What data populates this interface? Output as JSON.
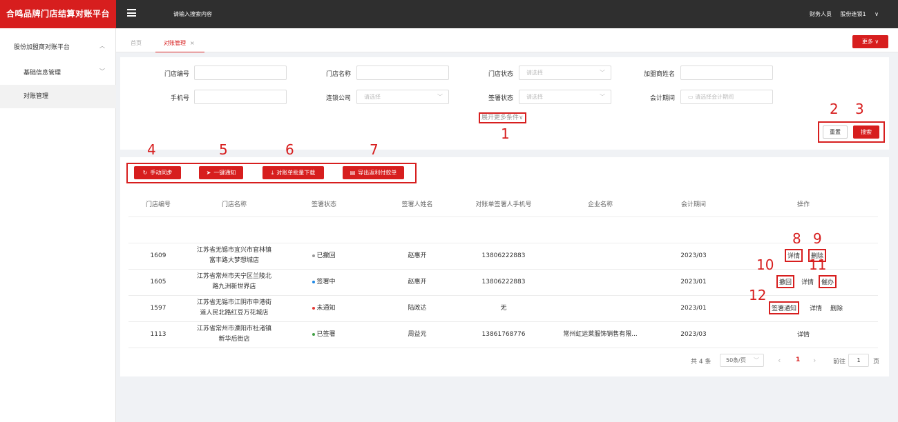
{
  "app": {
    "title": "合鸣品牌门店结算对账平台"
  },
  "topbar": {
    "search_placeholder": "请输入搜索内容",
    "role": "财务人员",
    "user": "股份连锁1",
    "user_chevron": "∨"
  },
  "sidebar": {
    "platform": "股份加盟商对账平台",
    "items": [
      {
        "label": "基础信息管理"
      },
      {
        "label": "对账管理"
      }
    ]
  },
  "tabs": {
    "home": "首页",
    "current": "对账管理",
    "close": "×",
    "more_label": "更多 ∨"
  },
  "filters": {
    "store_code_label": "门店编号",
    "store_name_label": "门店名称",
    "store_status_label": "门店状态",
    "store_status_placeholder": "请选择",
    "franchisee_label": "加盟商姓名",
    "phone_label": "手机号",
    "chain_company_label": "连锁公司",
    "chain_company_placeholder": "请选择",
    "sign_status_label": "签署状态",
    "sign_status_placeholder": "请选择",
    "period_label": "会计期间",
    "period_placeholder": "请选择会计期间",
    "expand_label": "展开更多条件∨",
    "reset_label": "重置",
    "search_label": "搜索"
  },
  "actions": {
    "sync": "手动同步",
    "notify": "一键通知",
    "download": "对账单批量下载",
    "export": "导出返利付款单"
  },
  "table": {
    "headers": [
      "门店编号",
      "门店名称",
      "签署状态",
      "签署人姓名",
      "对账单签署人手机号",
      "企业名称",
      "会计期间",
      "操作"
    ],
    "rows": [
      {
        "code": "1609",
        "name1": "江苏省无锡市宜兴市官林镇",
        "name2": "富丰路大梦想城店",
        "status": "已撤回",
        "signer": "赵惠开",
        "phone": "13806222883",
        "company": "",
        "period": "2023/03"
      },
      {
        "code": "1605",
        "name1": "江苏省常州市天宁区兰陵北",
        "name2": "路九洲新世界店",
        "status": "签署中",
        "signer": "赵惠开",
        "phone": "13806222883",
        "company": "",
        "period": "2023/01"
      },
      {
        "code": "1597",
        "name1": "江苏省无锡市江阴市申港街",
        "name2": "道人民北路红豆万花城店",
        "status": "未通知",
        "signer": "陆政达",
        "phone": "无",
        "company": "",
        "period": "2023/01"
      },
      {
        "code": "1113",
        "name1": "江苏省常州市溧阳市社渚镇",
        "name2": "新华后街店",
        "status": "已签署",
        "signer": "周益元",
        "phone": "13861768776",
        "company": "常州虹运莱服饰销售有限...",
        "period": "2023/03"
      }
    ],
    "ops": {
      "detail": "详情",
      "delete": "删除",
      "revoke": "撤回",
      "urge": "催办",
      "sign_notify": "签署通知"
    }
  },
  "pagination": {
    "total": "共 4 条",
    "page_size": "50条/页",
    "prev": "‹",
    "current": "1",
    "next": "›",
    "goto_label": "前往",
    "goto_value": "1",
    "page_unit": "页"
  },
  "annotations": [
    "1",
    "2",
    "3",
    "4",
    "5",
    "6",
    "7",
    "8",
    "9",
    "10",
    "11",
    "12"
  ],
  "colors": {
    "brand": "#d71e1e",
    "topbar": "#2f2f2f",
    "dot_revoked": "#999999",
    "dot_signing": "#1e88e5",
    "dot_not_notified": "#e53935",
    "dot_signed": "#43a047"
  }
}
